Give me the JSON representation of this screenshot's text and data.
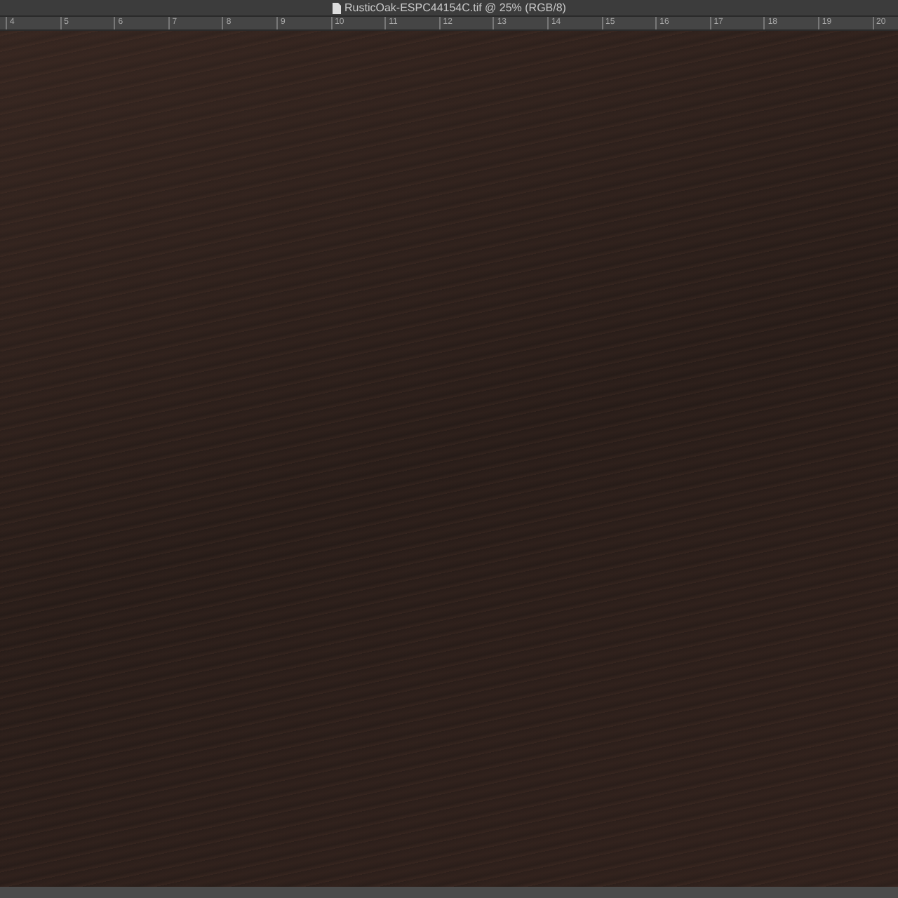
{
  "window": {
    "title": "RusticOak-ESPC44154C.tif @ 25% (RGB/8)"
  },
  "ruler": {
    "ticks": [
      "4",
      "5",
      "6",
      "7",
      "8",
      "9",
      "10",
      "11",
      "12",
      "13",
      "14",
      "15",
      "16",
      "17",
      "18",
      "19",
      "20"
    ]
  }
}
